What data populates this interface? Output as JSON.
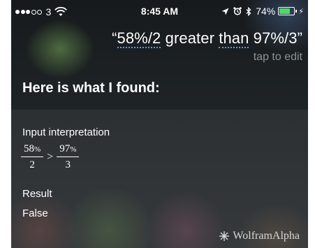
{
  "status_bar": {
    "carrier": "3",
    "time": "8:45 AM",
    "battery_percent_text": "74%",
    "battery_level": 0.74,
    "signal_bars_filled": 3,
    "signal_bars_total": 5,
    "icons": [
      "wifi-icon",
      "location-arrow-icon",
      "alarm-icon",
      "bluetooth-icon",
      "battery-icon",
      "charging-icon"
    ]
  },
  "siri": {
    "query_open_quote": "“",
    "query_part1": "58%/2",
    "query_part2": " greater ",
    "query_part3": "than",
    "query_part4": " 97%/3",
    "query_close_quote": "”",
    "tap_to_edit": "tap to edit",
    "heading": "Here is what I found:"
  },
  "result_card": {
    "interpretation_label": "Input interpretation",
    "left_fraction": {
      "numerator": "58",
      "percent": "%",
      "denominator": "2"
    },
    "operator": ">",
    "right_fraction": {
      "numerator": "97",
      "percent": "%",
      "denominator": "3"
    },
    "result_label": "Result",
    "result_value": "False",
    "source_name": "WolframAlpha"
  },
  "colors": {
    "spellcheck_underline": "#4aa3ff",
    "battery_fill": "#4cd964",
    "secondary_text": "#8e9194"
  }
}
